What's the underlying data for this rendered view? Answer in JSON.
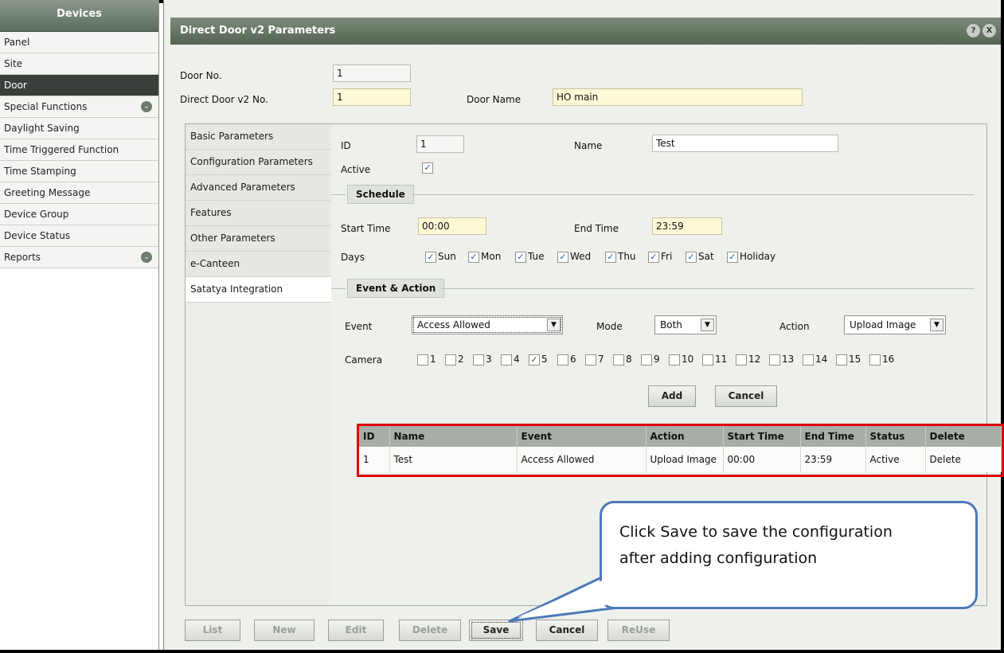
{
  "sidebar": {
    "title": "Devices",
    "items": [
      {
        "label": "Panel"
      },
      {
        "label": "Site"
      },
      {
        "label": "Door",
        "active": true
      },
      {
        "label": "Special Functions",
        "expandable": true
      },
      {
        "label": "Daylight Saving"
      },
      {
        "label": "Time Triggered Function"
      },
      {
        "label": "Time Stamping"
      },
      {
        "label": "Greeting Message"
      },
      {
        "label": "Device Group"
      },
      {
        "label": "Device Status"
      },
      {
        "label": "Reports",
        "expandable": true
      }
    ]
  },
  "window": {
    "title": "Direct Door v2 Parameters",
    "help_glyph": "?",
    "close_glyph": "X"
  },
  "header": {
    "door_no_label": "Door No.",
    "door_no_value": "1",
    "dd_no_label": "Direct Door v2 No.",
    "dd_no_value": "1",
    "door_name_label": "Door Name",
    "door_name_value": "HO main"
  },
  "tabs": [
    {
      "label": "Basic Parameters"
    },
    {
      "label": "Configuration Parameters"
    },
    {
      "label": "Advanced Parameters"
    },
    {
      "label": "Features"
    },
    {
      "label": "Other Parameters"
    },
    {
      "label": "e-Canteen"
    },
    {
      "label": "Satatya Integration",
      "active": true
    }
  ],
  "form": {
    "id_label": "ID",
    "id_value": "1",
    "name_label": "Name",
    "name_value": "Test",
    "active_label": "Active",
    "active_checked": true,
    "schedule_legend": "Schedule",
    "start_time_label": "Start Time",
    "start_time_value": "00:00",
    "end_time_label": "End Time",
    "end_time_value": "23:59",
    "days_label": "Days",
    "days": [
      "Sun",
      "Mon",
      "Tue",
      "Wed",
      "Thu",
      "Fri",
      "Sat",
      "Holiday"
    ],
    "event_action_legend": "Event & Action",
    "event_label": "Event",
    "event_value": "Access Allowed",
    "mode_label": "Mode",
    "mode_value": "Both",
    "action_label": "Action",
    "action_value": "Upload Image",
    "camera_label": "Camera",
    "cameras": [
      "1",
      "2",
      "3",
      "4",
      "5",
      "6",
      "7",
      "8",
      "9",
      "10",
      "11",
      "12",
      "13",
      "14",
      "15",
      "16"
    ],
    "camera_checked": "5",
    "add_label": "Add",
    "cancel_label": "Cancel"
  },
  "table": {
    "headers": [
      "ID",
      "Name",
      "Event",
      "Action",
      "Start Time",
      "End Time",
      "Status",
      "Delete"
    ],
    "rows": [
      [
        "1",
        "Test",
        "Access Allowed",
        "Upload Image",
        "00:00",
        "23:59",
        "Active",
        "Delete"
      ]
    ]
  },
  "callout": {
    "line1": "Click Save to save the configuration",
    "line2": "after adding configuration"
  },
  "toolbar": {
    "list_label": "List",
    "new_label": "New",
    "edit_label": "Edit",
    "delete_label": "Delete",
    "save_label": "Save",
    "cancel_label": "Cancel",
    "reuse_label": "ReUse"
  },
  "glyphs": {
    "check": "✓",
    "dropdown": "▼",
    "expand": "⌄"
  },
  "colors": {
    "accent_title": "#5c6b5b",
    "highlight_border": "#e00000",
    "callout_border": "#4e79b8",
    "input_yellow": "#fdf8d6"
  }
}
